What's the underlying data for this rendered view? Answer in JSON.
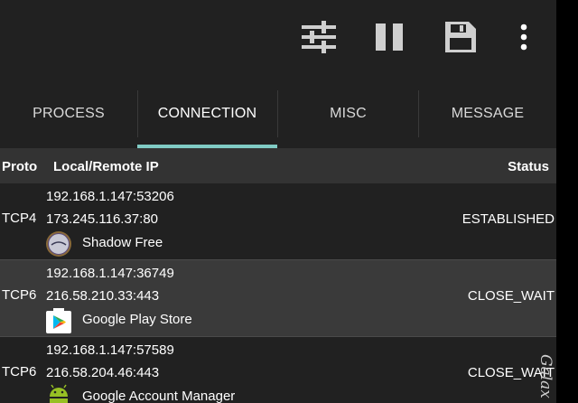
{
  "colors": {
    "background": "#212121",
    "header": "#333333",
    "row_alt": "#3a3a3a",
    "accent": "#80cbc4"
  },
  "toolbar": {
    "icons": [
      "tune-icon",
      "pause-icon",
      "save-icon",
      "more-vert-icon"
    ]
  },
  "tabs": [
    {
      "label": "PROCESS"
    },
    {
      "label": "CONNECTION",
      "active": true
    },
    {
      "label": "MISC"
    },
    {
      "label": "MESSAGE"
    }
  ],
  "table": {
    "headers": {
      "proto": "Proto",
      "ip": "Local/Remote IP",
      "status": "Status"
    },
    "rows": [
      {
        "proto": "TCP4",
        "local": "192.168.1.147:53206",
        "remote": "173.245.116.37:80",
        "app": "Shadow Free",
        "status": "ESTABLISHED",
        "icon": "shadow-app-icon"
      },
      {
        "proto": "TCP6",
        "local": "192.168.1.147:36749",
        "remote": "216.58.210.33:443",
        "app": "Google Play Store",
        "status": "CLOSE_WAIT",
        "icon": "play-store-icon"
      },
      {
        "proto": "TCP6",
        "local": "192.168.1.147:57589",
        "remote": "216.58.204.46:443",
        "app": "Google Account Manager",
        "status": "CLOSE_WAIT",
        "icon": "android-icon"
      }
    ]
  },
  "watermark": "Galax"
}
